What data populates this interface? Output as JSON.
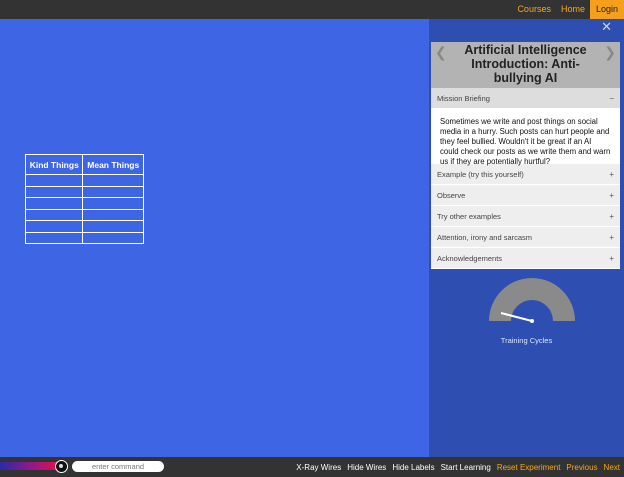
{
  "topnav": {
    "courses": "Courses",
    "home": "Home",
    "login": "Login"
  },
  "table": {
    "headers": [
      "Kind Things",
      "Mean Things"
    ],
    "rows": [
      [
        "",
        ""
      ],
      [
        "",
        ""
      ],
      [
        "",
        ""
      ],
      [
        "",
        ""
      ],
      [
        "",
        ""
      ],
      [
        "",
        ""
      ]
    ]
  },
  "panel": {
    "close": "✕",
    "prev": "❮",
    "next": "❯",
    "title": "Artificial Intelligence Introduction: Anti-bullying AI",
    "sections": [
      {
        "label": "Mission Briefing",
        "toggle": "−",
        "open": true
      },
      {
        "label": "Example (try this yourself)",
        "toggle": "+"
      },
      {
        "label": "Observe",
        "toggle": "+"
      },
      {
        "label": "Try other examples",
        "toggle": "+"
      },
      {
        "label": "Attention, irony and sarcasm",
        "toggle": "+"
      },
      {
        "label": "Acknowledgements",
        "toggle": "+"
      }
    ],
    "briefing_text": "Sometimes we write and post things on social media in a hurry. Such posts can hurt people and they feel bullied. Wouldn't it be great if an AI could check our posts as we write them and warn us if they are potentially hurtful?"
  },
  "gauge": {
    "label": "Training Cycles",
    "value": 0.08
  },
  "bottombar": {
    "command_placeholder": "enter command",
    "links": [
      {
        "label": "X-Ray Wires",
        "color": "#ffffff"
      },
      {
        "label": "Hide Wires",
        "color": "#ffffff"
      },
      {
        "label": "Hide Labels",
        "color": "#ffffff"
      },
      {
        "label": "Start Learning",
        "color": "#ffffff"
      },
      {
        "label": "Reset Experiment",
        "color": "#f5a623"
      },
      {
        "label": "Previous",
        "color": "#f5a623"
      },
      {
        "label": "Next",
        "color": "#f5a623"
      }
    ]
  },
  "colors": {
    "background": "#3e65e4",
    "sidebar": "#2e4fb1",
    "accent": "#f5a623",
    "bar": "#333333"
  }
}
